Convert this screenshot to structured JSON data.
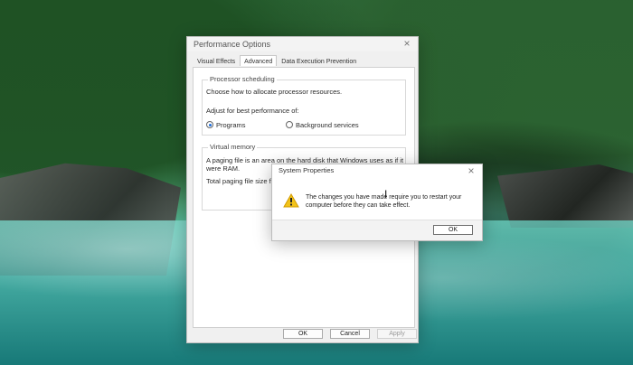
{
  "performance_window": {
    "title": "Performance Options",
    "tabs": [
      "Visual Effects",
      "Advanced",
      "Data Execution Prevention"
    ],
    "processor_scheduling": {
      "title": "Processor scheduling",
      "description": "Choose how to allocate processor resources.",
      "adjust_label": "Adjust for best performance of:",
      "option_programs": "Programs",
      "option_background": "Background services"
    },
    "virtual_memory": {
      "title": "Virtual memory",
      "description_line1": "A paging file is an area on the hard disk that Windows uses as if it",
      "description_line2": "were RAM.",
      "total_label": "Total paging file size fo"
    },
    "buttons": {
      "ok": "OK",
      "cancel": "Cancel",
      "apply": "Apply"
    }
  },
  "system_properties_dialog": {
    "title": "System Properties",
    "message_line1": "The changes you have made require you to restart your",
    "message_line2": "computer before they can take effect.",
    "ok": "OK"
  },
  "icons": {
    "close": "close-icon",
    "warning": "warning-icon",
    "cursor": "cursor-icon"
  }
}
